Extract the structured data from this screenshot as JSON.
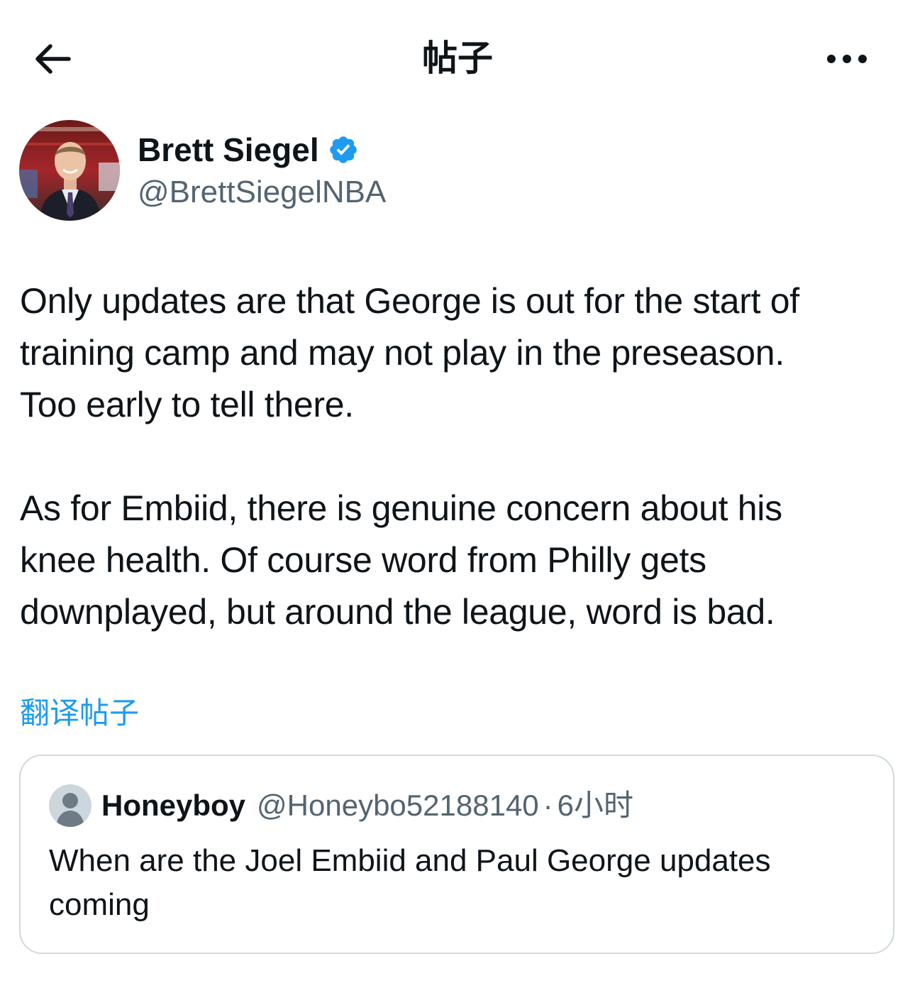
{
  "header": {
    "title": "帖子",
    "back_icon": "arrow-left-icon",
    "more_icon": "more-horizontal-icon"
  },
  "post": {
    "author": {
      "name": "Brett Siegel",
      "handle": "@BrettSiegelNBA",
      "verified": true,
      "verified_color": "#1d9bf0"
    },
    "paragraphs": [
      "Only updates are that George is out for the start of\ntraining camp and may not play in the preseason.\nToo early to tell there.",
      "As for Embiid, there is genuine concern about his\nknee health. Of course word from Philly gets\ndownplayed, but around the league, word is bad."
    ],
    "translate_label": "翻译帖子"
  },
  "quoted_post": {
    "author": {
      "name": "Honeyboy",
      "handle": "@Honeybo52188140",
      "separator": "·",
      "time": "6小时"
    },
    "text": "When are the Joel Embiid and Paul George updates\ncoming"
  },
  "colors": {
    "text": "#0f1419",
    "secondary": "#536471",
    "accent": "#1d9bf0",
    "border": "#cfd9de"
  }
}
